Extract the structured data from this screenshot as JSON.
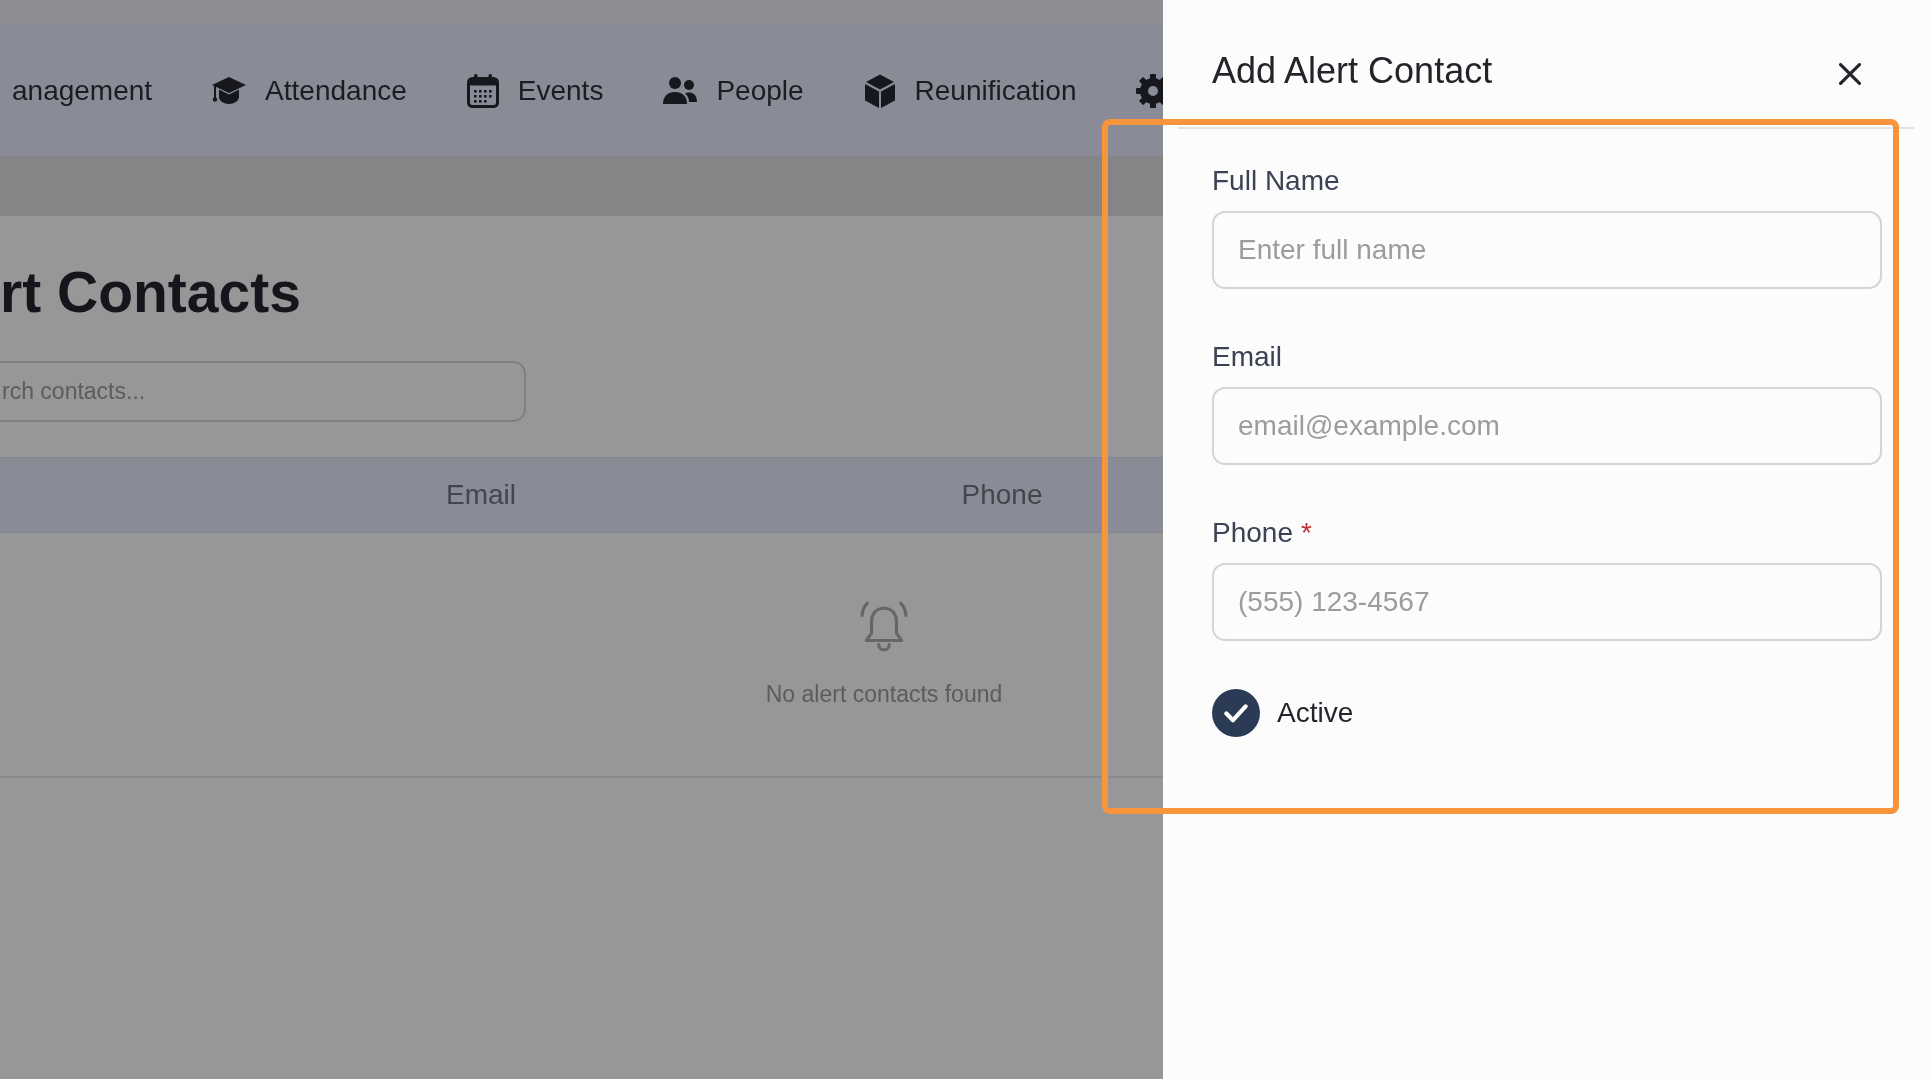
{
  "navbar": {
    "items": [
      {
        "label": "anagement"
      },
      {
        "label": "Attendance"
      },
      {
        "label": "Events"
      },
      {
        "label": "People"
      },
      {
        "label": "Reunification"
      }
    ]
  },
  "page": {
    "title": "rt Contacts",
    "search": {
      "placeholder": "rch contacts..."
    }
  },
  "table": {
    "columns": [
      "Email",
      "Phone"
    ],
    "empty_message": "No alert contacts found"
  },
  "offcanvas": {
    "title": "Add Alert Contact",
    "fields": [
      {
        "label": "Full Name",
        "placeholder": "Enter full name"
      },
      {
        "label": "Email",
        "placeholder": "email@example.com"
      },
      {
        "label": "Phone",
        "required_mark": "*",
        "placeholder": "(555) 123-4567"
      }
    ],
    "active": {
      "label": "Active",
      "checked": true
    }
  },
  "annotation": {
    "kind": "highlight-frame"
  }
}
